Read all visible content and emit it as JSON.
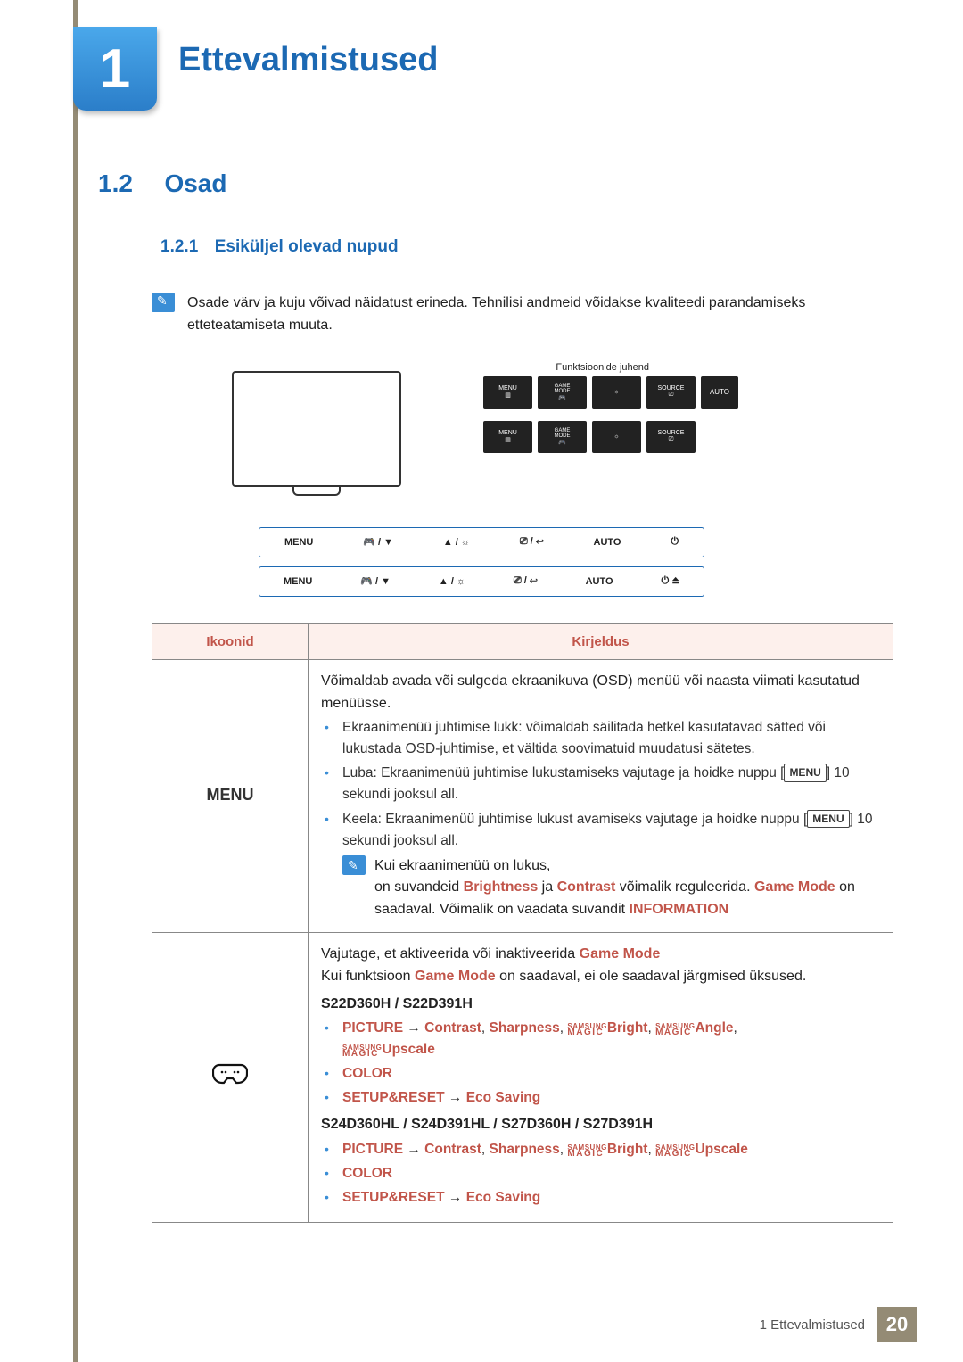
{
  "chapter": {
    "number": "1",
    "title": "Ettevalmistused"
  },
  "section": {
    "number": "1.2",
    "title": "Osad"
  },
  "subsection": {
    "number": "1.2.1",
    "title": "Esiküljel olevad nupud"
  },
  "intro_note": "Osade värv ja kuju võivad näidatust erineda. Tehnilisi andmeid võidakse kvaliteedi parandamiseks etteteatamiseta muuta.",
  "diagram": {
    "guide_label": "Funktsioonide juhend",
    "top_labels": [
      "MENU",
      "GAME MODE",
      "",
      "SOURCE",
      "AUTO"
    ],
    "btnrow1": [
      "MENU",
      "🎮 / ▼",
      "▲ / ☼",
      "⎚ / ↩",
      "AUTO",
      "⏻"
    ],
    "btnrow2": [
      "MENU",
      "🎮 / ▼",
      "▲ / ☼",
      "⎚ / ↩",
      "AUTO",
      "⏻ ⏏"
    ]
  },
  "table": {
    "head_icons": "Ikoonid",
    "head_desc": "Kirjeldus",
    "row1": {
      "icon_label": "MENU",
      "p1": "Võimaldab avada või sulgeda ekraanikuva (OSD) menüü või naasta viimati kasutatud menüüsse.",
      "b1": "Ekraanimenüü juhtimise lukk: võimaldab säilitada hetkel kasutatavad sätted või lukustada OSD-juhtimise, et vältida soovimatuid muudatusi sätetes.",
      "b2a": "Luba: Ekraanimenüü juhtimise lukustamiseks vajutage ja hoidke nuppu [",
      "b2b": "] 10 sekundi jooksul all.",
      "b3a": "Keela: Ekraanimenüü juhtimise lukust avamiseks vajutage ja hoidke nuppu [",
      "b3b": "] 10 sekundi jooksul all.",
      "menu_in_bracket": "MENU",
      "note1": "Kui ekraanimenüü on lukus,",
      "note2a": "on suvandeid ",
      "note_bright": "Brightness",
      "note_and": " ja ",
      "note_contrast": "Contrast",
      "note2b": " võimalik reguleerida. ",
      "note_game": "Game Mode",
      "note2c": " on saadaval. Võimalik on vaadata suvandit ",
      "note_info": "INFORMATION"
    },
    "row2": {
      "p1a": "Vajutage, et aktiveerida või inaktiveerida ",
      "p1_game": "Game Mode",
      "p2a": "Kui funktsioon ",
      "p2_game": "Game Mode",
      "p2b": " on saadaval, ei ole saadaval järgmised üksused.",
      "models1": "S22D360H / S22D391H",
      "pic_label": "PICTURE",
      "arrow": " → ",
      "contrast": "Contrast",
      "sep": ", ",
      "sharpness": "Sharpness",
      "bright": "Bright",
      "angle": "Angle",
      "upscale": "Upscale",
      "color": "COLOR",
      "setup": "SETUP&RESET",
      "eco": "Eco Saving",
      "models2": "S24D360HL / S24D391HL / S27D360H / S27D391H"
    }
  },
  "footer": {
    "chapter_ref": "1 Ettevalmistused",
    "page": "20"
  }
}
